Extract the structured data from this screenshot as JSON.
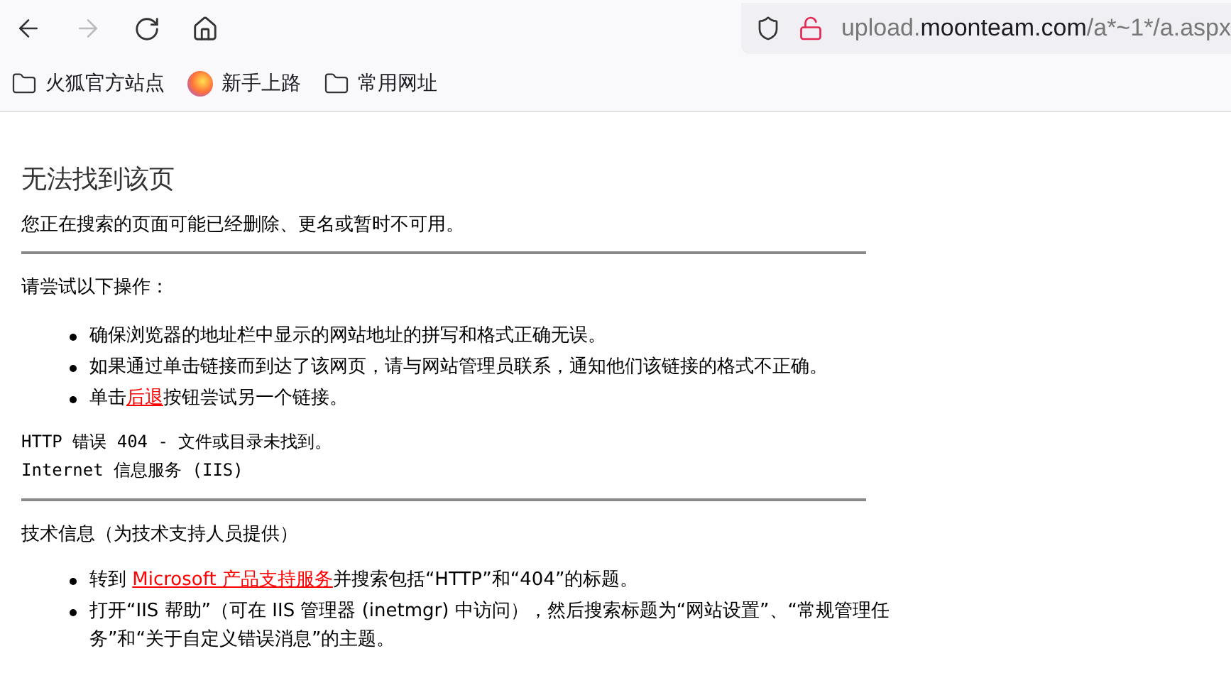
{
  "url": {
    "prefix": "upload.",
    "domain": "moonteam.com",
    "path": "/a*~1*/a.aspx"
  },
  "bookmarks": [
    {
      "kind": "folder",
      "label": "火狐官方站点"
    },
    {
      "kind": "firefox",
      "label": "新手上路"
    },
    {
      "kind": "folder",
      "label": "常用网址"
    }
  ],
  "page": {
    "title": "无法找到该页",
    "intro": "您正在搜索的页面可能已经删除、更名或暂时不可用。",
    "try_heading": "请尝试以下操作：",
    "try_items": [
      {
        "before": "确保浏览器的地址栏中显示的网站地址的拼写和格式正确无误。"
      },
      {
        "before": "如果通过单击链接而到达了该网页，请与网站管理员联系，通知他们该链接的格式不正确。"
      },
      {
        "before": "单击",
        "link": "后退",
        "after": "按钮尝试另一个链接。"
      }
    ],
    "error_line": "HTTP 错误 404 - 文件或目录未找到。",
    "server_line": "Internet 信息服务 (IIS)",
    "tech_heading": "技术信息（为技术支持人员提供）",
    "tech_items": [
      {
        "before": "转到 ",
        "link": "Microsoft 产品支持服务",
        "after": "并搜索包括“HTTP”和“404”的标题。"
      },
      {
        "before": "打开“IIS 帮助”（可在 IIS 管理器 (inetmgr) 中访问），然后搜索标题为“网站设置”、“常规管理任务”和“关于自定义错误消息”的主题。"
      }
    ]
  }
}
